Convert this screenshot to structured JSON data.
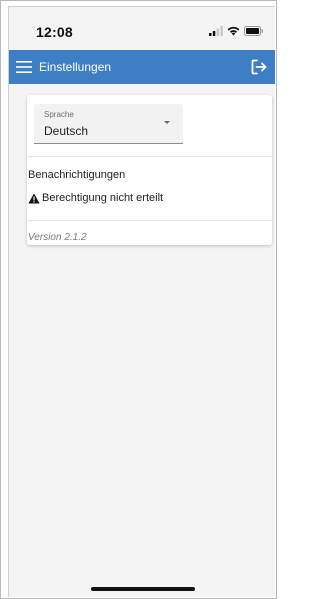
{
  "status_bar": {
    "time": "12:08"
  },
  "app_bar": {
    "title": "Einstellungen",
    "menu_icon": "hamburger-menu-icon",
    "logout_icon": "logout-icon",
    "color": "#3d7ec4"
  },
  "settings": {
    "language": {
      "label": "Sprache",
      "value": "Deutsch"
    },
    "notifications": {
      "title": "Benachrichtigungen",
      "warning_icon": "warning-icon",
      "status": "Berechtigung nicht erteilt"
    },
    "version": "Version 2.1.2"
  }
}
